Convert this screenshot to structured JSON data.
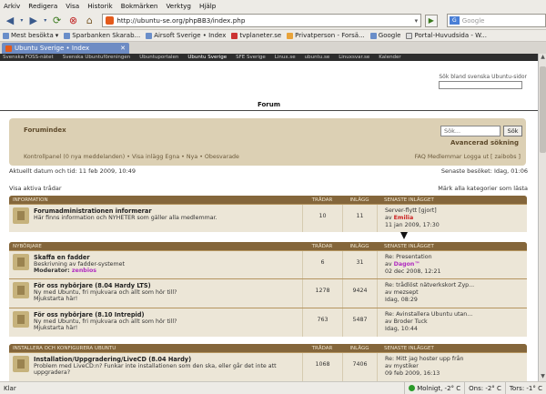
{
  "menu": [
    "Arkiv",
    "Redigera",
    "Visa",
    "Historik",
    "Bokmärken",
    "Verktyg",
    "Hjälp"
  ],
  "toolbar": {
    "url": "http://ubuntu-se.org/phpBB3/index.php",
    "search_placeholder": "Google"
  },
  "bookmarks": [
    "Mest besökta",
    "Sparbanken Skarab...",
    "Airsoft Sverige • Index",
    "tvplaneter.se",
    "Privatperson - Forsä...",
    "Google",
    "Portal-Huvudsida - W..."
  ],
  "tab": {
    "title": "Ubuntu Sverige • Index"
  },
  "ubnav": [
    "Svenska FOSS-nätet",
    "Svenska Ubuntuföreningen",
    "Ubuntuportalen",
    "Ubuntu Sverige",
    "SFE Sverige",
    "Linux.se",
    "ubuntu.se",
    "Linuxsvar.se",
    "Kalender"
  ],
  "page": {
    "search_label": "Sök bland svenska Ubuntu-sidor",
    "forum_heading": "Forum",
    "panel": {
      "title": "Forumindex",
      "search_input": "Sök...",
      "search_button": "Sök",
      "advanced": "Avancerad sökning",
      "left_links": "Kontrollpanel (0 nya meddelanden) • Visa inlägg  Egna • Nya • Obesvarade",
      "right_links": "FAQ   Medlemmar   Logga ut [ zaibobs ]"
    },
    "date": "Aktuellt datum och tid: 11 feb 2009, 10:49",
    "last_visit": "Senaste besöket: Idag, 01:06",
    "active": "Visa aktiva trådar",
    "mark_read": "Märk alla kategorier som lästa"
  },
  "col_headers": {
    "topics": "TRÅDAR",
    "posts": "INLÄGG",
    "last": "SENASTE INLÄGGET"
  },
  "categories": [
    {
      "name": "INFORMATION",
      "forums": [
        {
          "title": "Forumadministrationen informerar",
          "desc": "Här finns information och NYHETER som gäller alla medlemmar.",
          "topics": "10",
          "posts": "11",
          "last_title": "Server-flytt [gjort]",
          "last_by": "av",
          "last_user": "Emilia",
          "last_time": "11 jan 2009, 17:30",
          "user_class": "red"
        }
      ]
    },
    {
      "name": "NYBÖRJARE",
      "forums": [
        {
          "title": "Skaffa en fadder",
          "desc": "Beskrivning av fadder-systemet",
          "mods": "Moderator: ",
          "mod_name": "zenbios",
          "topics": "6",
          "posts": "31",
          "last_title": "Re: Presentation",
          "last_by": "av",
          "last_user": "Dagon™",
          "last_time": "02 dec 2008, 12:21",
          "user_class": "mag"
        },
        {
          "title": "För oss nybörjare (8.04 Hardy LTS)",
          "desc": "Ny med Ubuntu, fri mjukvara och allt som hör till?",
          "mods": "Mjukstarta här!",
          "mod_name": "",
          "topics": "1278",
          "posts": "9424",
          "last_title": "Re: trådlöst nätverkskort Zyp...",
          "last_by": "av",
          "last_user": "mezsept",
          "last_time": "Idag, 08:29",
          "user_class": ""
        },
        {
          "title": "För oss nybörjare (8.10 Intrepid)",
          "desc": "Ny med Ubuntu, fri mjukvara och allt som hör till?",
          "mods": "Mjukstarta här!",
          "mod_name": "",
          "topics": "763",
          "posts": "5487",
          "last_title": "Re: Avinstallera Ubuntu utan...",
          "last_by": "av",
          "last_user": "Broder Tuck",
          "last_time": "Idag, 10:44",
          "user_class": ""
        }
      ]
    },
    {
      "name": "INSTALLERA OCH KONFIGURERA UBUNTU",
      "forums": [
        {
          "title": "Installation/Uppgradering/LiveCD (8.04 Hardy)",
          "desc": "Problem med LiveCD:n? Funkar inte installationen som den ska, eller går det inte att uppgradera?",
          "mods": "",
          "mod_name": "",
          "topics": "1068",
          "posts": "7406",
          "last_title": "Re: Mitt jag hoster upp från",
          "last_by": "av",
          "last_user": "mystiker",
          "last_time": "09 feb 2009, 16:13",
          "user_class": ""
        }
      ]
    }
  ],
  "status": {
    "left": "Klar",
    "weather1": "Molnigt, -2° C",
    "weather2": "Ons: -2° C",
    "weather3": "Tors: -1° C"
  }
}
